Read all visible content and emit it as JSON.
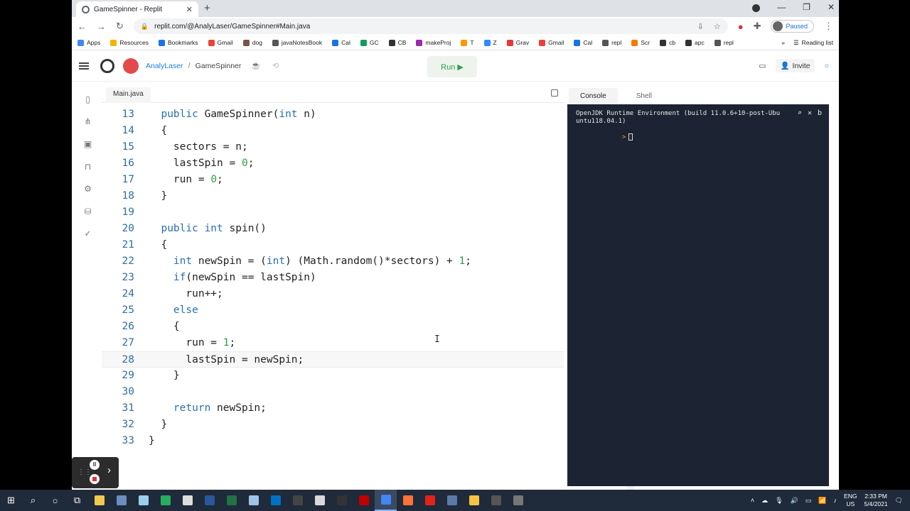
{
  "browser": {
    "tab_title": "GameSpinner - Replit",
    "url": "replit.com/@AnalyLaser/GameSpinner#Main.java",
    "profile_status": "Paused",
    "bookmarks": [
      {
        "label": "Apps",
        "color": "#4285f4"
      },
      {
        "label": "Resources",
        "color": "#f4b400"
      },
      {
        "label": "Bookmarks",
        "color": "#1a73e8"
      },
      {
        "label": "Gmail",
        "color": "#ea4335"
      },
      {
        "label": "dog",
        "color": "#795548"
      },
      {
        "label": "javaNotesBook",
        "color": "#555555"
      },
      {
        "label": "Cal",
        "color": "#1a73e8"
      },
      {
        "label": "GC",
        "color": "#0f9d58"
      },
      {
        "label": "CB",
        "color": "#333333"
      },
      {
        "label": "makeProj",
        "color": "#9c27b0"
      },
      {
        "label": "T",
        "color": "#ff9800"
      },
      {
        "label": "Z",
        "color": "#2d8cff"
      },
      {
        "label": "Grav",
        "color": "#e53935"
      },
      {
        "label": "Gmail",
        "color": "#ea4335"
      },
      {
        "label": "Cal",
        "color": "#1a73e8"
      },
      {
        "label": "repl",
        "color": "#555555"
      },
      {
        "label": "Scr",
        "color": "#f57c00"
      },
      {
        "label": "cb",
        "color": "#333333"
      },
      {
        "label": "apc",
        "color": "#333333"
      },
      {
        "label": "repl",
        "color": "#555555"
      }
    ],
    "reading_list": "Reading list",
    "overflow": "»"
  },
  "replit": {
    "owner": "AnalyLaser",
    "separator": "/",
    "repl_name": "GameSpinner",
    "run_label": "Run ▶",
    "invite_label": "Invite",
    "file_tab": "Main.java",
    "console_tab": "Console",
    "shell_tab": "Shell"
  },
  "code": {
    "current_line": 28,
    "lines": [
      {
        "n": "13",
        "segs": [
          [
            "  ",
            ""
          ],
          [
            "public ",
            "kw"
          ],
          [
            "GameSpinner(",
            ""
          ],
          [
            "int ",
            "kw"
          ],
          [
            "n)",
            ""
          ]
        ]
      },
      {
        "n": "14",
        "segs": [
          [
            "  {",
            ""
          ]
        ]
      },
      {
        "n": "15",
        "segs": [
          [
            "    sectors = n;",
            ""
          ]
        ]
      },
      {
        "n": "16",
        "segs": [
          [
            "    lastSpin = ",
            ""
          ],
          [
            "0",
            "num"
          ],
          [
            ";",
            ""
          ]
        ]
      },
      {
        "n": "17",
        "segs": [
          [
            "    run = ",
            ""
          ],
          [
            "0",
            "num"
          ],
          [
            ";",
            ""
          ]
        ]
      },
      {
        "n": "18",
        "segs": [
          [
            "  }",
            ""
          ]
        ]
      },
      {
        "n": "19",
        "segs": [
          [
            "",
            ""
          ]
        ]
      },
      {
        "n": "20",
        "segs": [
          [
            "  ",
            ""
          ],
          [
            "public ",
            "kw"
          ],
          [
            "int ",
            "kw"
          ],
          [
            "spin()",
            ""
          ]
        ]
      },
      {
        "n": "21",
        "segs": [
          [
            "  {",
            ""
          ]
        ]
      },
      {
        "n": "22",
        "segs": [
          [
            "    ",
            ""
          ],
          [
            "int ",
            "kw"
          ],
          [
            "newSpin = (",
            ""
          ],
          [
            "int",
            "kw"
          ],
          [
            ") (Math.random()*sectors) + ",
            ""
          ],
          [
            "1",
            "num"
          ],
          [
            ";",
            ""
          ]
        ]
      },
      {
        "n": "23",
        "segs": [
          [
            "    ",
            ""
          ],
          [
            "if",
            "kw"
          ],
          [
            "(newSpin == lastSpin)",
            ""
          ]
        ]
      },
      {
        "n": "24",
        "segs": [
          [
            "      run++;",
            ""
          ]
        ]
      },
      {
        "n": "25",
        "segs": [
          [
            "    ",
            ""
          ],
          [
            "else",
            "kw"
          ]
        ]
      },
      {
        "n": "26",
        "segs": [
          [
            "    {",
            ""
          ]
        ]
      },
      {
        "n": "27",
        "segs": [
          [
            "      run = ",
            ""
          ],
          [
            "1",
            "num"
          ],
          [
            ";",
            ""
          ]
        ]
      },
      {
        "n": "28",
        "segs": [
          [
            "      lastSpin = newSpin;",
            ""
          ]
        ]
      },
      {
        "n": "29",
        "segs": [
          [
            "    }",
            ""
          ]
        ]
      },
      {
        "n": "30",
        "segs": [
          [
            "",
            ""
          ]
        ]
      },
      {
        "n": "31",
        "segs": [
          [
            "    ",
            ""
          ],
          [
            "return ",
            "kw"
          ],
          [
            "newSpin;",
            ""
          ]
        ]
      },
      {
        "n": "32",
        "segs": [
          [
            "  }",
            ""
          ]
        ]
      },
      {
        "n": "33",
        "segs": [
          [
            "}",
            ""
          ]
        ]
      }
    ]
  },
  "console": {
    "output_line1": "OpenJDK Runtime Environment (build 11.0.6+10-post-Ubu",
    "output_line2": "untu118.04.1)",
    "overflow_char": "b",
    "prompt": ">"
  },
  "taskbar": {
    "lang_line1": "ENG",
    "lang_line2": "US",
    "time": "2:33 PM",
    "date": "5/4/2021",
    "apps": [
      {
        "name": "file-explorer-icon",
        "color": "#f2c94c"
      },
      {
        "name": "camera-icon",
        "color": "#6c8ebf"
      },
      {
        "name": "pen-icon",
        "color": "#9ad0ec"
      },
      {
        "name": "green-app-icon",
        "color": "#27ae60"
      },
      {
        "name": "music-icon",
        "color": "#dddddd"
      },
      {
        "name": "word-icon",
        "color": "#2b579a"
      },
      {
        "name": "excel-icon",
        "color": "#217346"
      },
      {
        "name": "notepad-icon",
        "color": "#a0c4e8"
      },
      {
        "name": "outlook-icon",
        "color": "#0072c6"
      },
      {
        "name": "g-app-icon",
        "color": "#444444"
      },
      {
        "name": "doc-icon",
        "color": "#d9d9d9"
      },
      {
        "name": "inkscape-icon",
        "color": "#333333"
      },
      {
        "name": "filezilla-icon",
        "color": "#bf0000"
      },
      {
        "name": "chrome-icon",
        "color": "#4285f4"
      },
      {
        "name": "firefox-icon",
        "color": "#ff7139"
      },
      {
        "name": "acrobat-icon",
        "color": "#e2231a"
      },
      {
        "name": "calculator-icon",
        "color": "#5b7aa8"
      },
      {
        "name": "yellow-app-icon",
        "color": "#f6c343"
      },
      {
        "name": "vpn-icon",
        "color": "#555555"
      },
      {
        "name": "bug-icon",
        "color": "#777777"
      }
    ]
  }
}
